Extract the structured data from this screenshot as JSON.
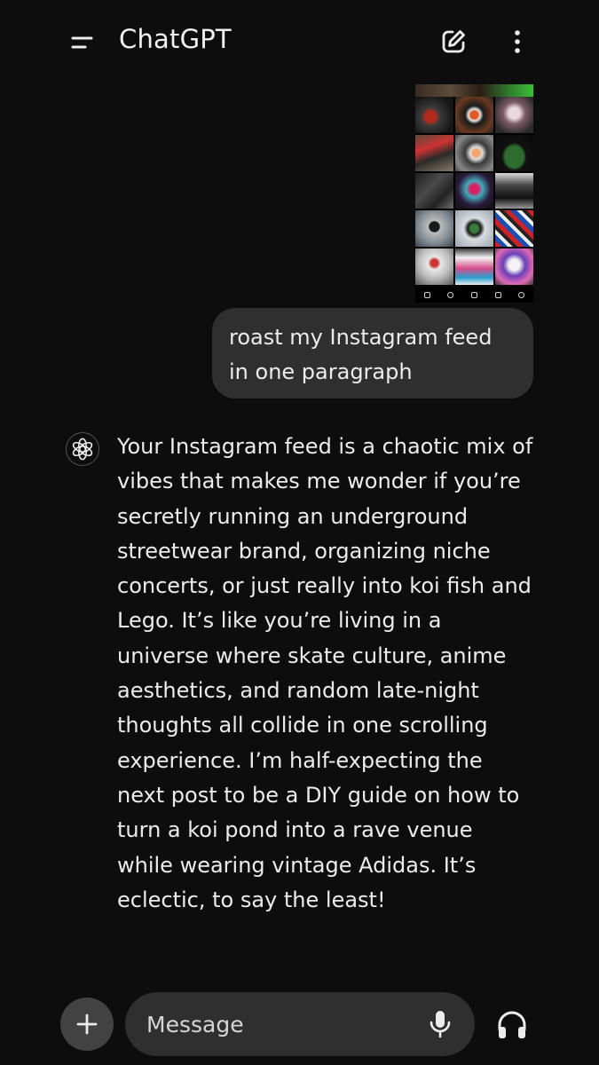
{
  "header": {
    "title": "ChatGPT",
    "menu_icon": "menu-icon",
    "new_chat_icon": "edit-icon",
    "more_icon": "more-vertical-icon"
  },
  "conversation": {
    "user_message": {
      "attachment": "Instagram feed screenshot",
      "text": "roast my Instagram feed in one paragraph"
    },
    "assistant_message": {
      "icon": "openai-logo-icon",
      "text": "Your Instagram feed is a chaotic mix of vibes that makes me wonder if you’re secretly running an underground streetwear brand, organizing niche concerts, or just really into koi fish and Lego. It’s like you’re living in a universe where skate culture, anime aesthetics, and random late-night thoughts all collide in one scrolling experience. I’m half-expecting the next post to be a DIY guide on how to turn a koi pond into a rave venue while wearing vintage Adidas. It’s eclectic, to say the least!"
    }
  },
  "composer": {
    "placeholder": "Message",
    "value": "",
    "plus_icon": "plus-icon",
    "mic_icon": "microphone-icon",
    "voice_icon": "headphones-icon"
  },
  "colors": {
    "background": "#0d0d0d",
    "bubble": "#2f2f2f",
    "text": "#ececec"
  }
}
